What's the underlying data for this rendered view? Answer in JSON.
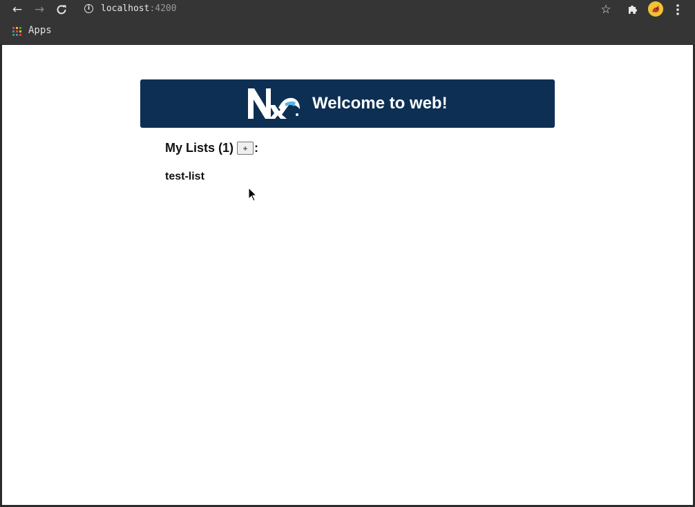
{
  "browser": {
    "url_host": "localhost",
    "url_port": ":4200",
    "bookmarks": [
      {
        "label": "Apps"
      }
    ]
  },
  "banner": {
    "title": "Welcome to web!",
    "background": "#0d2f53",
    "logo_icon": "nx-logo"
  },
  "lists": {
    "heading": "My Lists (1)",
    "add_label": "+",
    "suffix": ":",
    "items": [
      {
        "name": "test-list"
      }
    ]
  }
}
